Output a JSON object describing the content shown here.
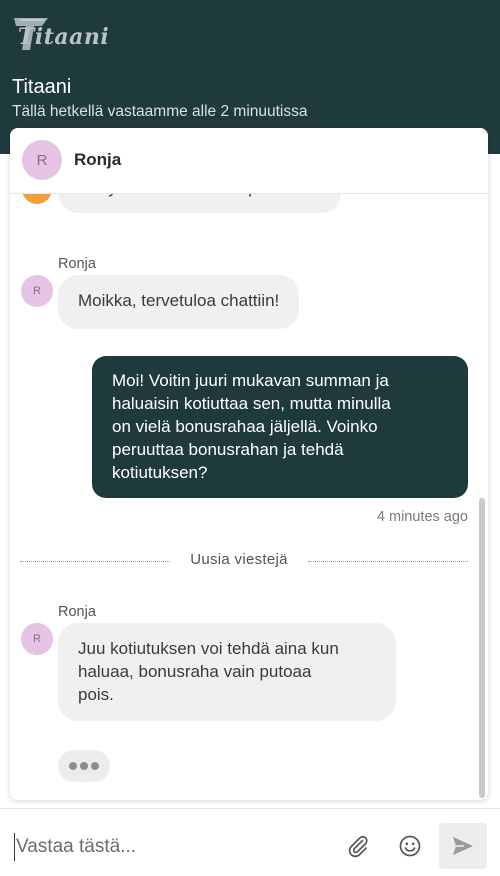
{
  "header": {
    "logo_text": "Titaani",
    "title": "Titaani",
    "subtitle": "Tällä hetkellä vastaamme alle 2 minuutissa"
  },
  "agent": {
    "initial": "R",
    "name": "Ronja"
  },
  "messages": [
    {
      "direction": "incoming",
      "text": "Siirryt Titaanin asiakaspalveluun",
      "partially_visible": true
    },
    {
      "direction": "incoming",
      "sender": "Ronja",
      "avatar_initial": "R",
      "text": "Moikka, tervetuloa chattiin!"
    },
    {
      "direction": "outgoing",
      "lines": [
        "Moi! Voitin juuri mukavan summan ja",
        "haluaisin kotiuttaa sen, mutta minulla",
        "on vielä bonusrahaa jäljellä. Voinko",
        "peruuttaa bonusrahan ja tehdä",
        "kotiutuksen?"
      ],
      "timestamp": "4 minutes ago"
    },
    {
      "direction": "incoming",
      "sender": "Ronja",
      "avatar_initial": "R",
      "lines": [
        "Juu kotiutuksen voi tehdä aina kun",
        "haluaa, bonusraha vain putoaa",
        "pois."
      ]
    }
  ],
  "divider": {
    "label": "Uusia viestejä"
  },
  "composer": {
    "placeholder": "Vastaa tästä...",
    "icons": {
      "attach": "paperclip-icon",
      "emoji": "smiley-icon",
      "send": "send-arrow-icon"
    }
  },
  "colors": {
    "brand_dark": "#1f3a3d",
    "avatar_bg": "#e4c3e4",
    "bubble_in": "#f0f0f0",
    "bot_avatar": "#f2a03a"
  }
}
